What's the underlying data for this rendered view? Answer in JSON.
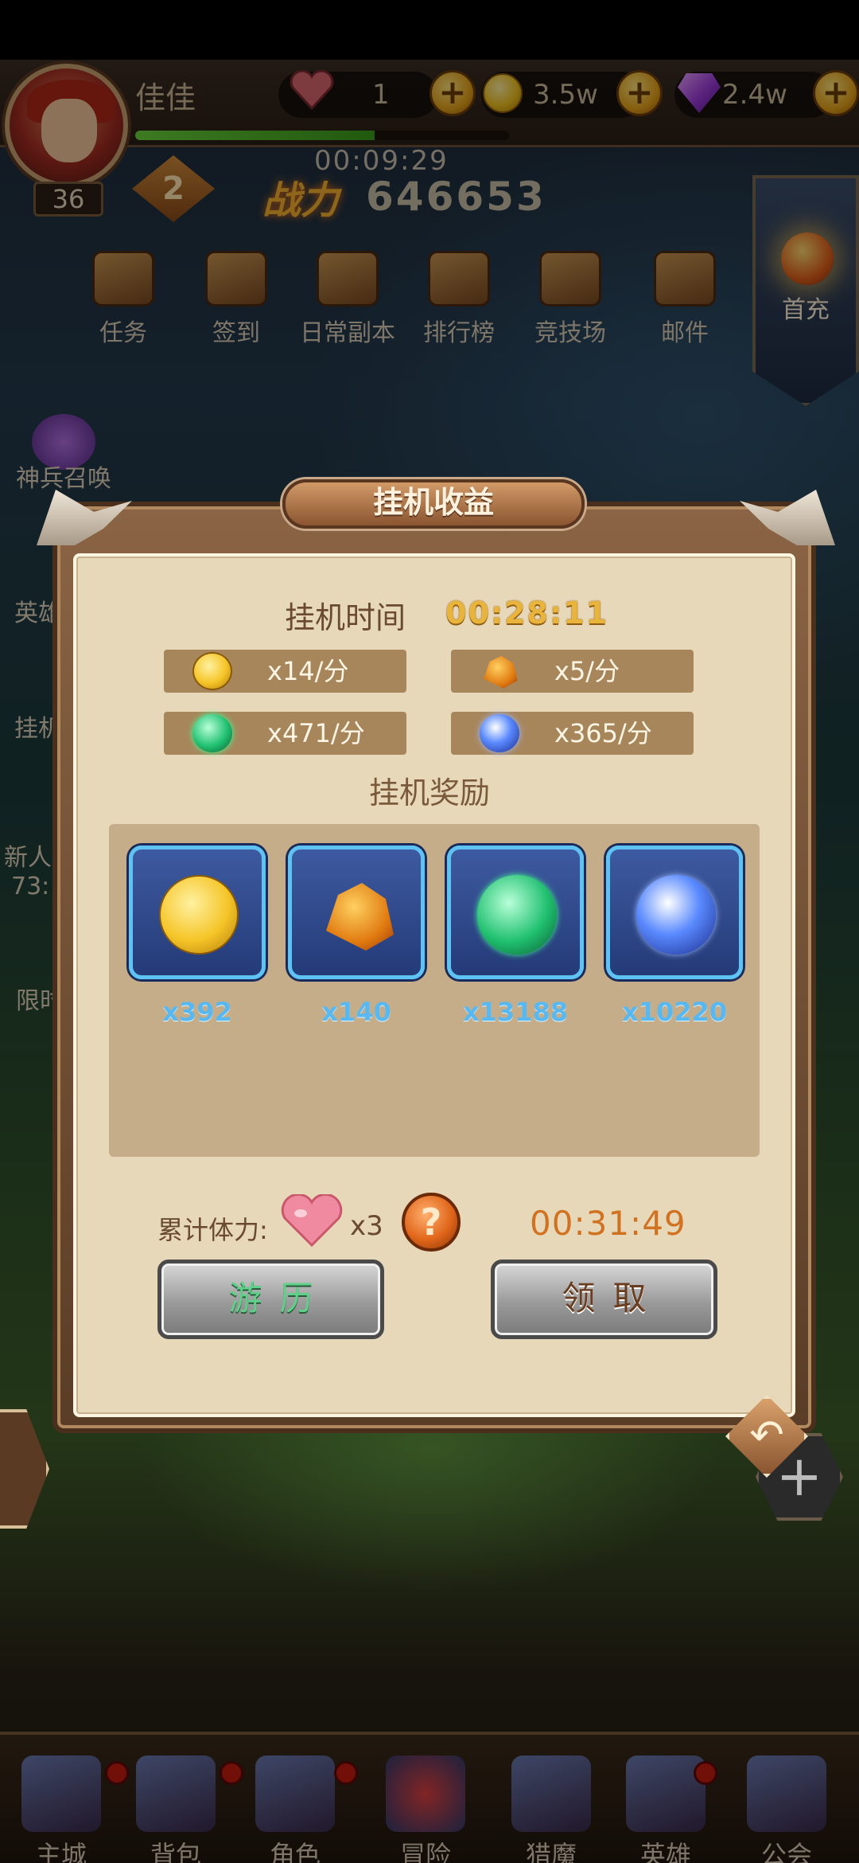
{
  "hud": {
    "player_name": "佳佳",
    "level": "36",
    "exp_fraction": 0.64,
    "stamina": "1",
    "gold": "3.5w",
    "diamonds": "2.4w",
    "timer": "00:09:29",
    "rank": "2",
    "power_label": "战力",
    "power_value": "646653"
  },
  "top_menu": [
    "任务",
    "签到",
    "日常副本",
    "排行榜",
    "竞技场",
    "邮件"
  ],
  "first_recharge": "首充",
  "side_menu": {
    "summon": "神兵召唤",
    "hero_partial": "英雄",
    "idle_partial": "挂机",
    "newbie_partial": "新人",
    "newbie_timer_partial": "73:",
    "limited_partial": "限时"
  },
  "dialog": {
    "title": "挂机收益",
    "idle_time_label": "挂机时间",
    "idle_time_value": "00:28:11",
    "rates": [
      {
        "icon": "gold-coin-icon",
        "text": "x14/分"
      },
      {
        "icon": "gold-ore-icon",
        "text": "x5/分"
      },
      {
        "icon": "green-orb-icon",
        "text": "x471/分"
      },
      {
        "icon": "blue-orb-icon",
        "text": "x365/分"
      }
    ],
    "rewards_title": "挂机奖励",
    "rewards": [
      {
        "icon": "gold-coin-icon",
        "qty": "x392"
      },
      {
        "icon": "gold-ore-icon",
        "qty": "x140"
      },
      {
        "icon": "green-orb-icon",
        "qty": "x13188"
      },
      {
        "icon": "blue-orb-icon",
        "qty": "x10220"
      }
    ],
    "stamina_label": "累计体力:",
    "stamina_qty": "x3",
    "help_symbol": "?",
    "countdown": "00:31:49",
    "travel_button": "游历",
    "claim_button": "领取",
    "back_symbol": "↶"
  },
  "bottom_nav": [
    "主城",
    "背包",
    "角色",
    "冒险",
    "猎魔",
    "英雄",
    "公会"
  ],
  "colors": {
    "accent_gold": "#e9b43c",
    "slot_blue": "#243b78",
    "slot_border": "#5ec3f2",
    "panel_cream": "#e8d8ba",
    "countdown_orange": "#d07220"
  }
}
